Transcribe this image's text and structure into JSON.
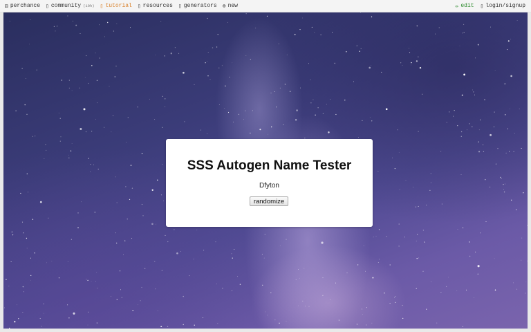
{
  "nav": {
    "left": [
      {
        "label": "perchance",
        "icon": "dice-icon"
      },
      {
        "label": "community",
        "badge": "(10h)",
        "icon": "chat-icon"
      },
      {
        "label": "tutorial",
        "icon": "book-icon"
      },
      {
        "label": "resources",
        "icon": "resources-icon"
      },
      {
        "label": "generators",
        "icon": "generators-icon"
      },
      {
        "label": "new",
        "icon": "plus-circle-icon"
      }
    ],
    "right": [
      {
        "label": "edit",
        "icon": "pencil-icon"
      },
      {
        "label": "login/signup",
        "icon": "user-icon"
      }
    ]
  },
  "colors": {
    "tutorial_accent": "#d9822b",
    "edit_green": "#2e8b2e"
  },
  "card": {
    "title": "SSS Autogen Name Tester",
    "result": "Dfyton",
    "button_label": "randomize"
  }
}
